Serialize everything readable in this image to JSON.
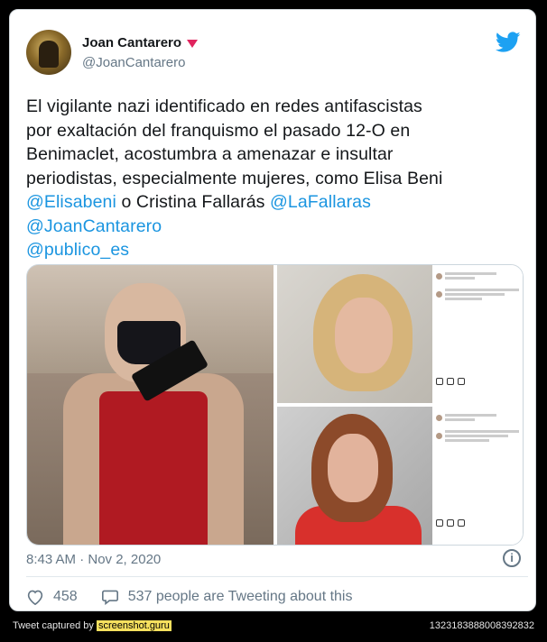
{
  "author": {
    "name": "Joan Cantarero",
    "handle": "@JoanCantarero"
  },
  "tweet": {
    "lines": [
      "El vigilante nazi identificado en redes antifascistas",
      "por exaltación del franquismo el pasado 12-O en",
      "Benimaclet, acostumbra a amenazar e insultar",
      "periodistas, especialmente mujeres, como Elisa Beni",
      {
        "mention1": "@Elisabeni",
        "text": " o Cristina Fallarás ",
        "mention2": "@LaFallaras"
      },
      "@JoanCantarero",
      " @publico_es"
    ]
  },
  "timestamp": "8:43 AM · Nov 2, 2020",
  "likes": "458",
  "replies_text": "537 people are Tweeting about this",
  "footer": {
    "prefix": "Tweet captured by ",
    "brand": "screenshot.guru",
    "id": "1323183888008392832"
  },
  "colors": {
    "mention": "#1b95e0",
    "twitter_blue": "#1da1f2",
    "muted": "#657786",
    "verified_triangle": "#e0245e"
  },
  "icons": [
    "twitter-bird-icon",
    "info-icon",
    "heart-icon",
    "reply-bubble-icon",
    "red-triangle-icon"
  ]
}
